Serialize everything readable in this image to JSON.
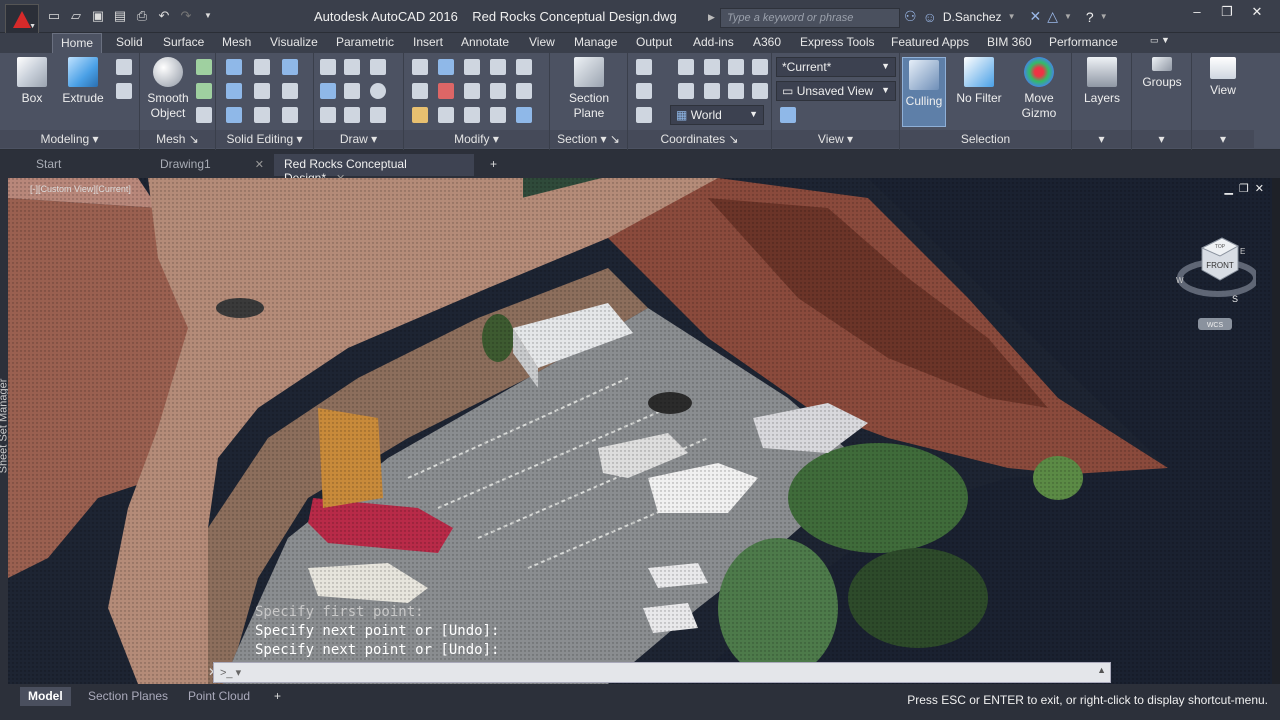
{
  "title_bar": {
    "app_name": "Autodesk AutoCAD 2016",
    "file_name": "Red Rocks Conceptual Design.dwg",
    "search_placeholder": "Type a keyword or phrase",
    "user_name": "D.Sanchez"
  },
  "ribbon_tabs": [
    {
      "label": "Home",
      "active": true
    },
    {
      "label": "Solid"
    },
    {
      "label": "Surface"
    },
    {
      "label": "Mesh"
    },
    {
      "label": "Visualize"
    },
    {
      "label": "Parametric"
    },
    {
      "label": "Insert"
    },
    {
      "label": "Annotate"
    },
    {
      "label": "View"
    },
    {
      "label": "Manage"
    },
    {
      "label": "Output"
    },
    {
      "label": "Add-ins"
    },
    {
      "label": "A360"
    },
    {
      "label": "Express Tools"
    },
    {
      "label": "Featured Apps"
    },
    {
      "label": "BIM 360"
    },
    {
      "label": "Performance"
    }
  ],
  "ribbon": {
    "box": "Box",
    "extrude": "Extrude",
    "smooth_object": "Smooth\nObject",
    "section_plane": "Section\nPlane",
    "culling": "Culling",
    "no_filter": "No Filter",
    "move_gizmo": "Move\nGizmo",
    "layers": "Layers",
    "groups": "Groups",
    "view": "View",
    "visual_style": "*Current*",
    "saved_view": "Unsaved View",
    "ucs": "World",
    "panels": {
      "modeling": "Modeling",
      "mesh": "Mesh",
      "solid_editing": "Solid Editing",
      "draw": "Draw",
      "modify": "Modify",
      "section": "Section",
      "coordinates": "Coordinates",
      "view": "View",
      "selection": "Selection"
    }
  },
  "doc_tabs": [
    {
      "label": "Start"
    },
    {
      "label": "Drawing1"
    },
    {
      "label": "Red Rocks Conceptual Design*",
      "active": true
    }
  ],
  "viewport": {
    "label": "[-][Custom View][Current]",
    "sheet_set_manager": "Sheet Set Manager",
    "viewcube": {
      "face": "FRONT",
      "top": "TOP",
      "n": "N",
      "s": "S",
      "e": "E",
      "w": "W",
      "wcs": "WCS"
    }
  },
  "command": {
    "history": [
      "Specify first point:",
      "Specify next point or [Undo]:",
      "Specify next point or [Undo]:"
    ]
  },
  "layout_tabs": [
    {
      "label": "Model",
      "active": true
    },
    {
      "label": "Section Planes"
    },
    {
      "label": "Point Cloud"
    }
  ],
  "status_message": "Press ESC or ENTER to exit, or right-click to display shortcut-menu."
}
